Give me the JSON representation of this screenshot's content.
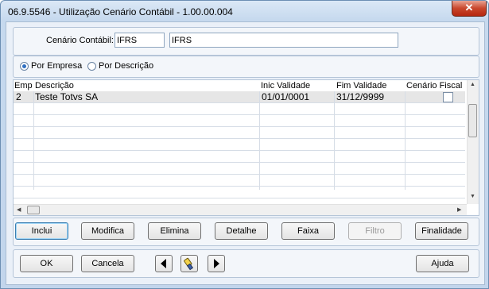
{
  "window": {
    "title": "06.9.5546 - Utilização Cenário Contábil - 1.00.00.004",
    "close_glyph": "✕"
  },
  "filter": {
    "label": "Cenário Contábil:",
    "code_value": "IFRS",
    "desc_value": "IFRS"
  },
  "order": {
    "option_empresa": "Por Empresa",
    "option_descricao": "Por Descrição",
    "selected": "Por Empresa"
  },
  "grid": {
    "columns": [
      "Emp",
      "Descrição",
      "Inic Validade",
      "Fim Validade",
      "Cenário Fiscal"
    ],
    "rows": [
      {
        "emp": "2",
        "descricao": "Teste Totvs SA",
        "inicio": "01/01/0001",
        "fim": "31/12/9999",
        "fiscal": false
      }
    ]
  },
  "actions": {
    "inclui": "Inclui",
    "modifica": "Modifica",
    "elimina": "Elimina",
    "detalhe": "Detalhe",
    "faixa": "Faixa",
    "filtro": "Filtro",
    "finalidade": "Finalidade"
  },
  "footer": {
    "ok": "OK",
    "cancela": "Cancela",
    "ajuda": "Ajuda"
  },
  "icons": {
    "prev": "triangle-left-icon",
    "search": "flashlight-icon",
    "next": "triangle-right-icon"
  }
}
